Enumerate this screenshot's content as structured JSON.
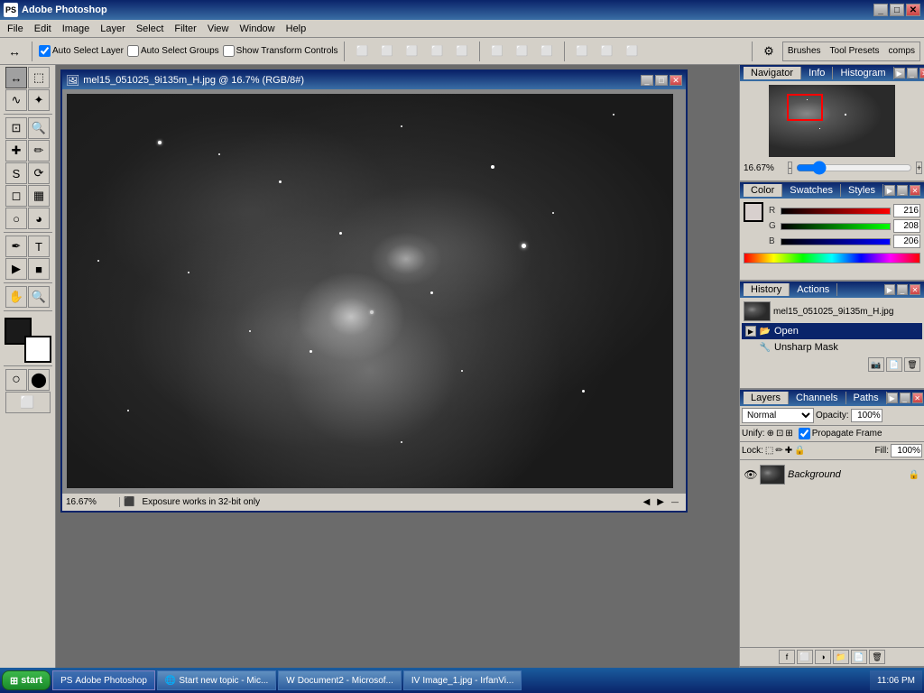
{
  "app": {
    "title": "Adobe Photoshop",
    "title_icon": "PS"
  },
  "menu": {
    "items": [
      "File",
      "Edit",
      "Image",
      "Layer",
      "Select",
      "Filter",
      "View",
      "Window",
      "Help"
    ]
  },
  "toolbar": {
    "auto_select_layer": "Auto Select Layer",
    "auto_select_groups": "Auto Select Groups",
    "show_transform_controls": "Show Transform Controls",
    "brushes_tab": "Brushes",
    "tool_presets_tab": "Tool Presets",
    "comps_tab": "comps"
  },
  "document": {
    "title": "mel15_051025_9i135m_H.jpg @ 16.7% (RGB/8#)",
    "zoom": "16.67%",
    "status": "Exposure works in 32-bit only"
  },
  "navigator": {
    "tab": "Navigator",
    "tab2": "Info",
    "tab3": "Histogram",
    "zoom_value": "16.67%"
  },
  "color_panel": {
    "tab_color": "Color",
    "tab_swatches": "Swatches",
    "tab_styles": "Styles",
    "r_label": "R",
    "g_label": "G",
    "b_label": "B",
    "r_value": "216",
    "g_value": "208",
    "b_value": "206"
  },
  "history_panel": {
    "tab_history": "History",
    "tab_actions": "Actions",
    "source_name": "mel15_051025_9i135m_H.jpg",
    "item_open": "Open",
    "item_unsharp": "Unsharp Mask"
  },
  "layers_panel": {
    "tab_layers": "Layers",
    "tab_channels": "Channels",
    "tab_paths": "Paths",
    "mode": "Normal",
    "opacity_label": "Opacity:",
    "opacity_value": "100%",
    "unify_label": "Unify:",
    "propagate_label": "Propagate Frame",
    "lock_label": "Lock:",
    "fill_label": "Fill:",
    "fill_value": "100%",
    "background_layer": "Background"
  },
  "taskbar": {
    "start_label": "start",
    "items": [
      {
        "label": "Adobe Photoshop",
        "icon": "PS"
      },
      {
        "label": "Start new topic - Mic...",
        "icon": "IE"
      },
      {
        "label": "Document2 - Microsof...",
        "icon": "W"
      },
      {
        "label": "Image_1.jpg - IrfanVi...",
        "icon": "IV"
      }
    ],
    "clock": "11:06 PM"
  }
}
